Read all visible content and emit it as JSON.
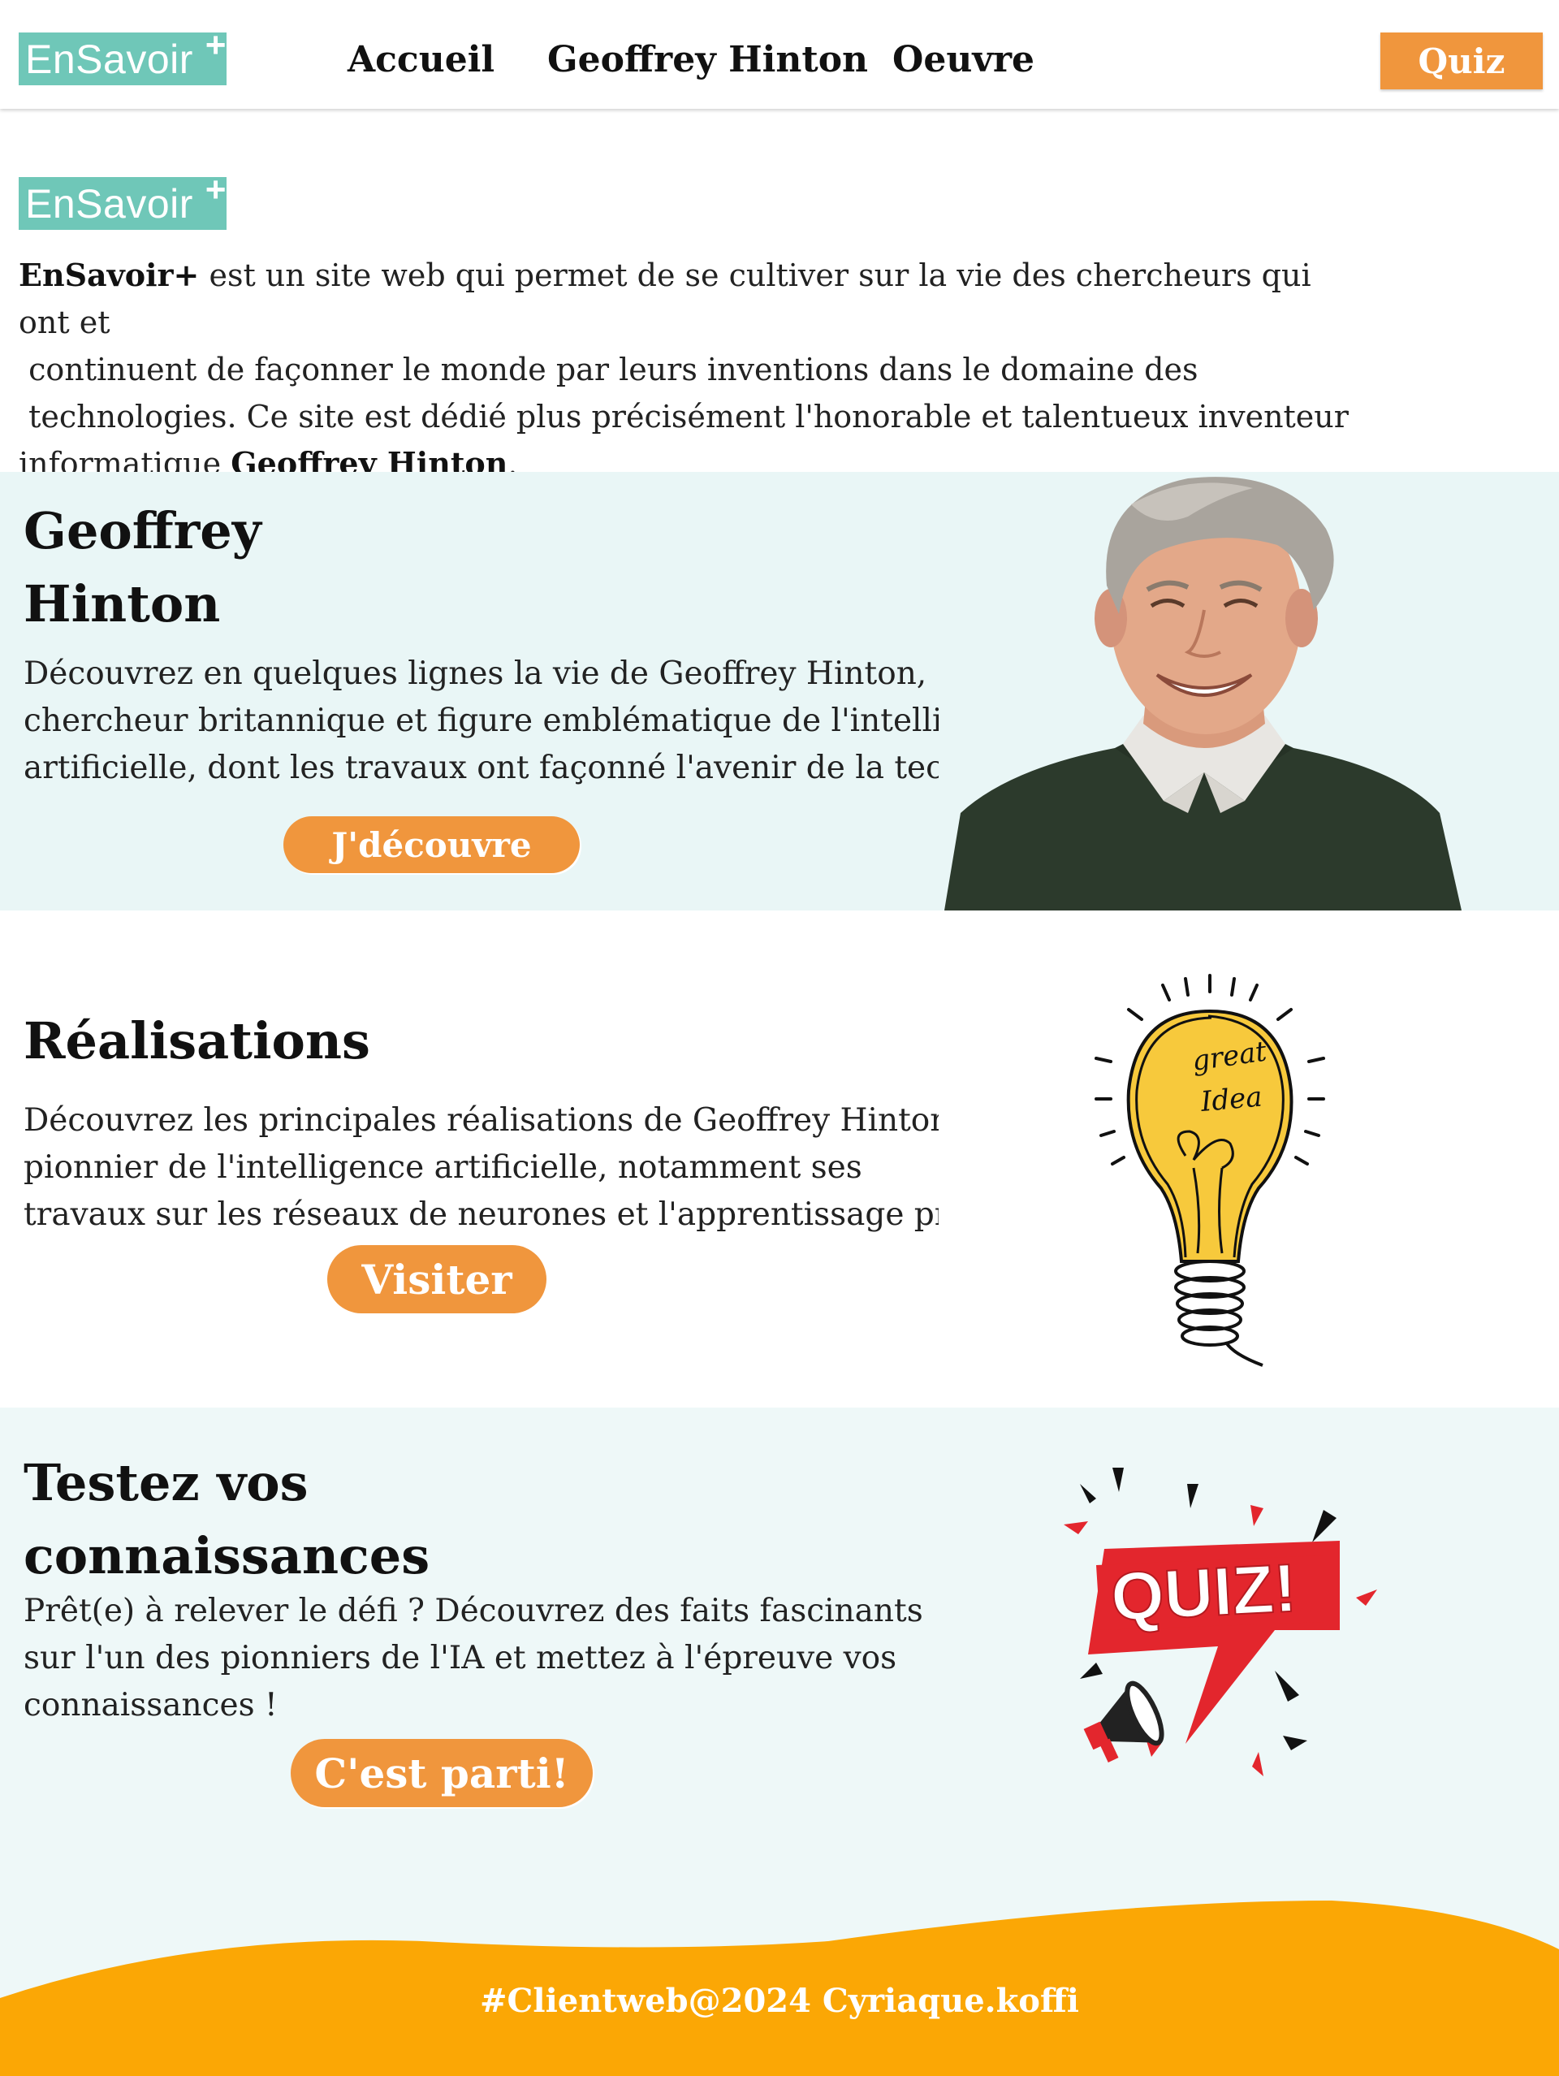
{
  "header": {
    "logo": "EnSavoir",
    "logo_plus": "+",
    "nav": [
      "Accueil",
      "Geoffrey Hinton",
      "Oeuvre"
    ],
    "quiz_button": "Quiz"
  },
  "intro": {
    "logo": "EnSavoir",
    "logo_plus": "+",
    "brand": "EnSavoir+",
    "line1_rest": " est un site web qui permet de se cultiver sur la vie des chercheurs qui ont et",
    "line2": " continuent de façonner le monde par leurs inventions dans le domaine des",
    "line3": " technologies. Ce site est dédié plus précisément l'honorable et talentueux inventeur",
    "line4_start": "informatique ",
    "line4_name": "Geoffrey Hinton",
    "line4_end": "."
  },
  "hinton_section": {
    "title_line1": "Geoffrey",
    "title_line2": "Hinton",
    "text_line1": "Découvrez en quelques lignes la vie de Geoffrey Hinton,",
    "text_line2": "chercheur britannique et figure emblématique de l'intelligence",
    "text_line3": "artificielle, dont les travaux ont façonné l'avenir de la technologie",
    "button": "J'découvre"
  },
  "realisations_section": {
    "title": "Réalisations",
    "text_line1": "Découvrez les principales réalisations de Geoffrey Hinton,",
    "text_line2": "pionnier de l'intelligence artificielle, notamment ses",
    "text_line3": "travaux sur les réseaux de neurones et l'apprentissage profond",
    "button": "Visiter",
    "bulb_text_1": "great",
    "bulb_text_2": "Idea"
  },
  "quiz_section": {
    "title_line1": "Testez vos",
    "title_line2": "connaissances",
    "text_line1": "Prêt(e) à relever le défi ? Découvrez des faits fascinants",
    "text_line2": "sur l'un des pionniers de l'IA et mettez à l'épreuve vos",
    "text_line3": "connaissances !",
    "button": "C'est parti!",
    "quiz_badge": "QUIZ!"
  },
  "footer": {
    "text": "#Clientweb@2024 Cyriaque.koffi"
  },
  "colors": {
    "accent": "#f0963d",
    "logo": "#6fc7b8",
    "section_bg": "#e9f6f6",
    "footer": "#fba705"
  }
}
